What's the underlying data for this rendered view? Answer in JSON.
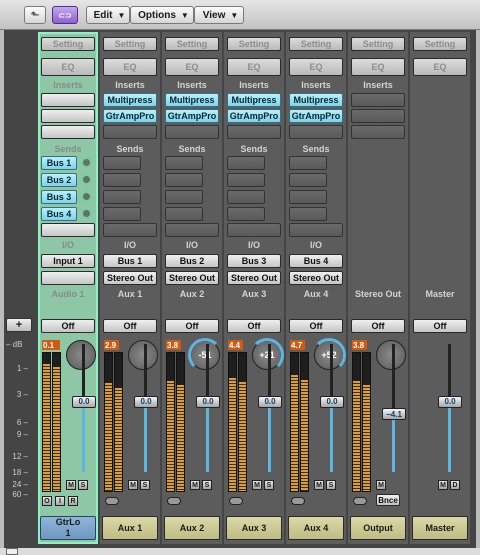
{
  "toolbar": {
    "back_glyph": "⬑",
    "link_glyph": "⊂⊃",
    "menus": [
      {
        "label": "Edit"
      },
      {
        "label": "Options"
      },
      {
        "label": "View"
      }
    ]
  },
  "rows": {
    "setting": "Setting",
    "eq": "EQ",
    "inserts": "Inserts",
    "sends": "Sends",
    "io": "I/O",
    "off": "Off",
    "db_label": "– dB",
    "plus": "+"
  },
  "scale": [
    "1",
    "3",
    "6",
    "9",
    "12",
    "18",
    "24",
    "60"
  ],
  "strips": [
    {
      "name": "GtrLo",
      "name2": "1",
      "group": "Audio 1",
      "inserts": [],
      "sends": [
        "Bus 1",
        "Bus 2",
        "Bus 3",
        "Bus 4"
      ],
      "input": "Input 1",
      "output": "",
      "peak": "0.1",
      "pan": "",
      "fader": "0.0",
      "meter": 0.92,
      "fader_level": 0.55,
      "buttons": [
        "M",
        "S"
      ],
      "extra": [
        "O",
        "I",
        "R"
      ],
      "selected": true
    },
    {
      "name": "Aux 1",
      "group": "Aux 1",
      "inserts": [
        "Multipress",
        "GtrAmpPro"
      ],
      "sends": [],
      "input": "Bus 1",
      "output": "Stereo Out",
      "peak": "2.9",
      "pan": "",
      "fader": "0.0",
      "meter": 0.78,
      "fader_level": 0.55,
      "buttons": [
        "M",
        "S"
      ]
    },
    {
      "name": "Aux 2",
      "group": "Aux 2",
      "inserts": [
        "Multipress",
        "GtrAmpPro"
      ],
      "sends": [],
      "input": "Bus 2",
      "output": "Stereo Out",
      "peak": "3.8",
      "pan": "-51",
      "fader": "0.0",
      "meter": 0.8,
      "fader_level": 0.55,
      "buttons": [
        "M",
        "S"
      ]
    },
    {
      "name": "Aux 3",
      "group": "Aux 3",
      "inserts": [
        "Multipress",
        "GtrAmpPro"
      ],
      "sends": [],
      "input": "Bus 3",
      "output": "Stereo Out",
      "peak": "4.4",
      "pan": "+21",
      "fader": "0.0",
      "meter": 0.82,
      "fader_level": 0.55,
      "buttons": [
        "M",
        "S"
      ]
    },
    {
      "name": "Aux 4",
      "group": "Aux 4",
      "inserts": [
        "Multipress",
        "GtrAmpPro"
      ],
      "sends": [],
      "input": "Bus 4",
      "output": "Stereo Out",
      "peak": "4.7",
      "pan": "+52",
      "fader": "0.0",
      "meter": 0.84,
      "fader_level": 0.55,
      "buttons": [
        "M",
        "S"
      ]
    },
    {
      "name": "Output",
      "group": "Stereo Out",
      "inserts": [],
      "sends": [],
      "input": "",
      "output": "",
      "peak": "3.8",
      "pan": "",
      "fader": "−4.1",
      "meter": 0.8,
      "fader_level": 0.45,
      "buttons": [
        "M"
      ],
      "bnce": "Bnce"
    },
    {
      "name": "Master",
      "group": "Master",
      "inserts": [],
      "sends": [],
      "input": "",
      "output": "",
      "peak": "",
      "pan": "",
      "fader": "0.0",
      "meter": 0,
      "fader_level": 0.55,
      "buttons": [
        "M",
        "D"
      ]
    }
  ],
  "colors": {
    "selected_border": "#8cf2c2",
    "plugin": "#7cd3ea",
    "meter": "#d9a035",
    "peak": "#d05a10",
    "fader": "#5db6e2",
    "name_button": "#dcd9a8"
  }
}
